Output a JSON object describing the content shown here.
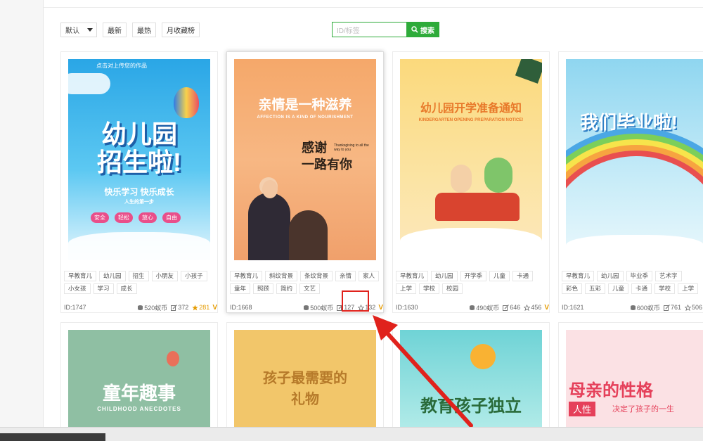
{
  "toolbar": {
    "sort_default": "默认",
    "sort_newest": "最新",
    "sort_hottest": "最热",
    "sort_monthly": "月收藏榜"
  },
  "search": {
    "placeholder": "ID/标签",
    "button_label": "搜索"
  },
  "colors": {
    "accent_green": "#2eab3a",
    "highlight_red": "#e0221c",
    "vip_gold": "#e59b00"
  },
  "cards": [
    {
      "poster": {
        "headline": "幼儿园",
        "headline2": "招生啦!",
        "slogan": "快乐学习 快乐成长",
        "sub": "人生的第一步",
        "chips": [
          "安全",
          "轻松",
          "放心",
          "自由"
        ],
        "banner": "点击对上传您的作品"
      },
      "tags": [
        "早教育儿",
        "幼儿园",
        "招生",
        "小朋友",
        "小孩子",
        "小女孩",
        "学习",
        "成长"
      ],
      "id": "ID:1747",
      "price": "520蚁币",
      "edits": "372",
      "favs": "281",
      "fav_hot": true
    },
    {
      "poster": {
        "headline": "亲情是一种滋养",
        "sub": "AFFECTION IS A KIND OF NOURISHMENT",
        "line1": "感谢",
        "line2": "一路有你",
        "note": "Thanksgiving to all the way to you"
      },
      "tags": [
        "早教育儿",
        "斜纹背景",
        "条纹背景",
        "亲情",
        "家人",
        "童年",
        "照顾",
        "简约",
        "文艺"
      ],
      "id": "ID:1668",
      "price": "500蚁币",
      "edits": "127",
      "favs": "132",
      "fav_hot": false
    },
    {
      "poster": {
        "headline": "幼儿园开学准备通知",
        "sub": "KINDERGARTEN OPENING PREPARATION NOTICE!"
      },
      "tags": [
        "早教育儿",
        "幼儿园",
        "开学季",
        "儿童",
        "卡通",
        "上学",
        "学校",
        "校园"
      ],
      "id": "ID:1630",
      "price": "490蚁币",
      "edits": "646",
      "favs": "456",
      "fav_hot": false
    },
    {
      "poster": {
        "headline": "我们毕业啦!"
      },
      "tags": [
        "早教育儿",
        "幼儿园",
        "毕业季",
        "艺术字",
        "彩色",
        "五彩",
        "儿童",
        "卡通",
        "学校",
        "上学"
      ],
      "id": "ID:1621",
      "price": "600蚁币",
      "edits": "761",
      "favs": "506",
      "fav_hot": false
    }
  ],
  "row2": [
    {
      "headline": "童年趣事",
      "sub": "CHILDHOOD ANECDOTES"
    },
    {
      "headline": "孩子最需要的",
      "headline2": "礼物"
    },
    {
      "headline": "教育孩子独立"
    },
    {
      "headline": "母亲的性格",
      "chip": "人性",
      "sub": "决定了孩子的一生"
    }
  ],
  "vip_mark": "V"
}
